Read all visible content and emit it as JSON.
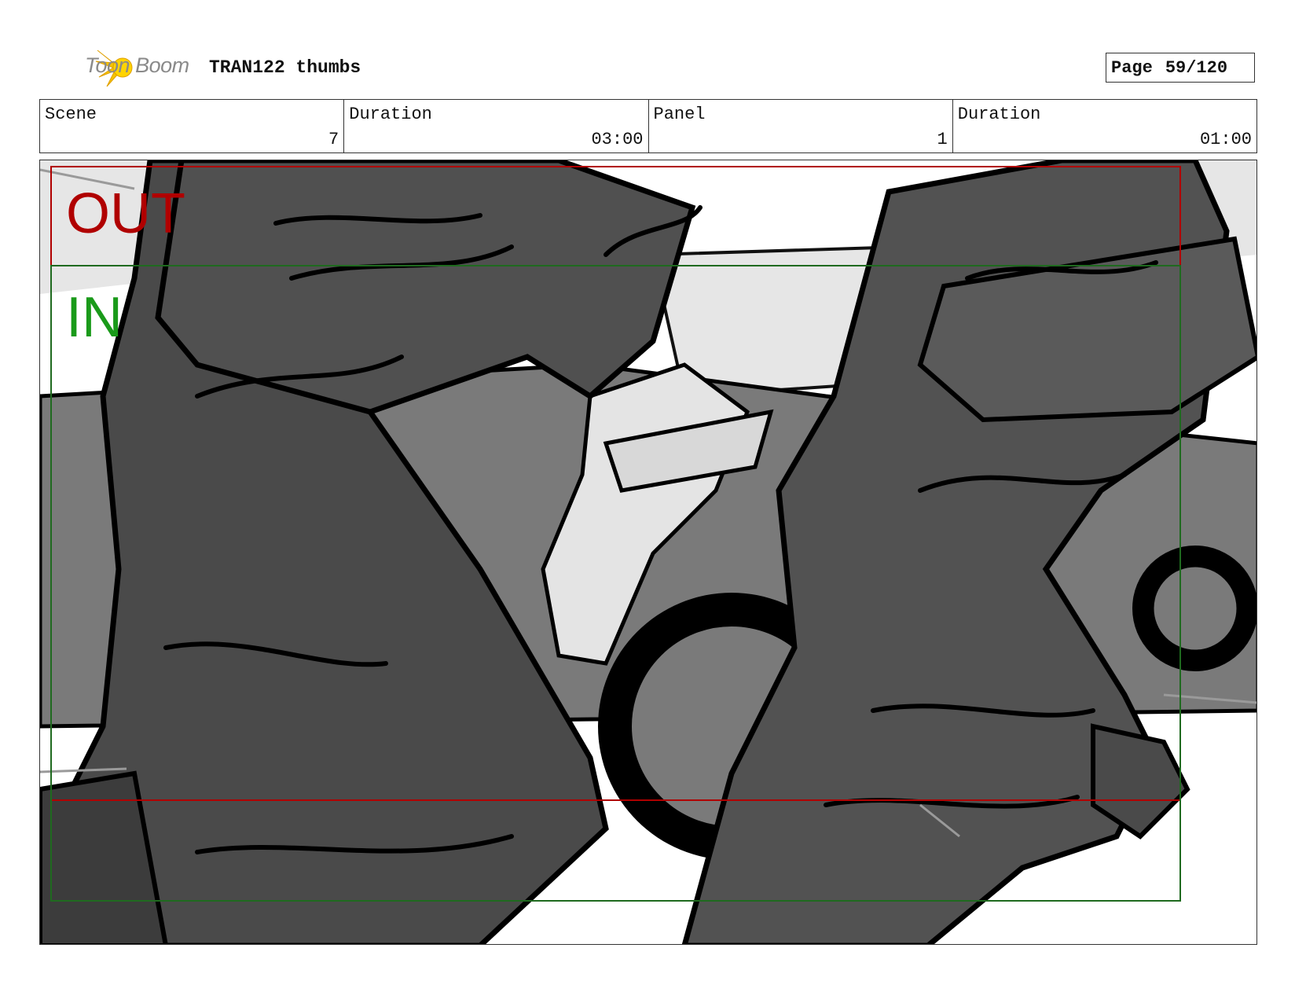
{
  "header": {
    "logo_text": "Toon Boom",
    "title": "TRAN122 thumbs",
    "page_label": "Page",
    "page_value": "59/120"
  },
  "info": {
    "scene_label": "Scene",
    "scene_value": "7",
    "duration1_label": "Duration",
    "duration1_value": "03:00",
    "panel_label": "Panel",
    "panel_value": "1",
    "duration2_label": "Duration",
    "duration2_value": "01:00"
  },
  "panel": {
    "out_label": "OUT",
    "in_label": "IN",
    "out_color": "#b00000",
    "in_color": "#1a9a1a"
  }
}
